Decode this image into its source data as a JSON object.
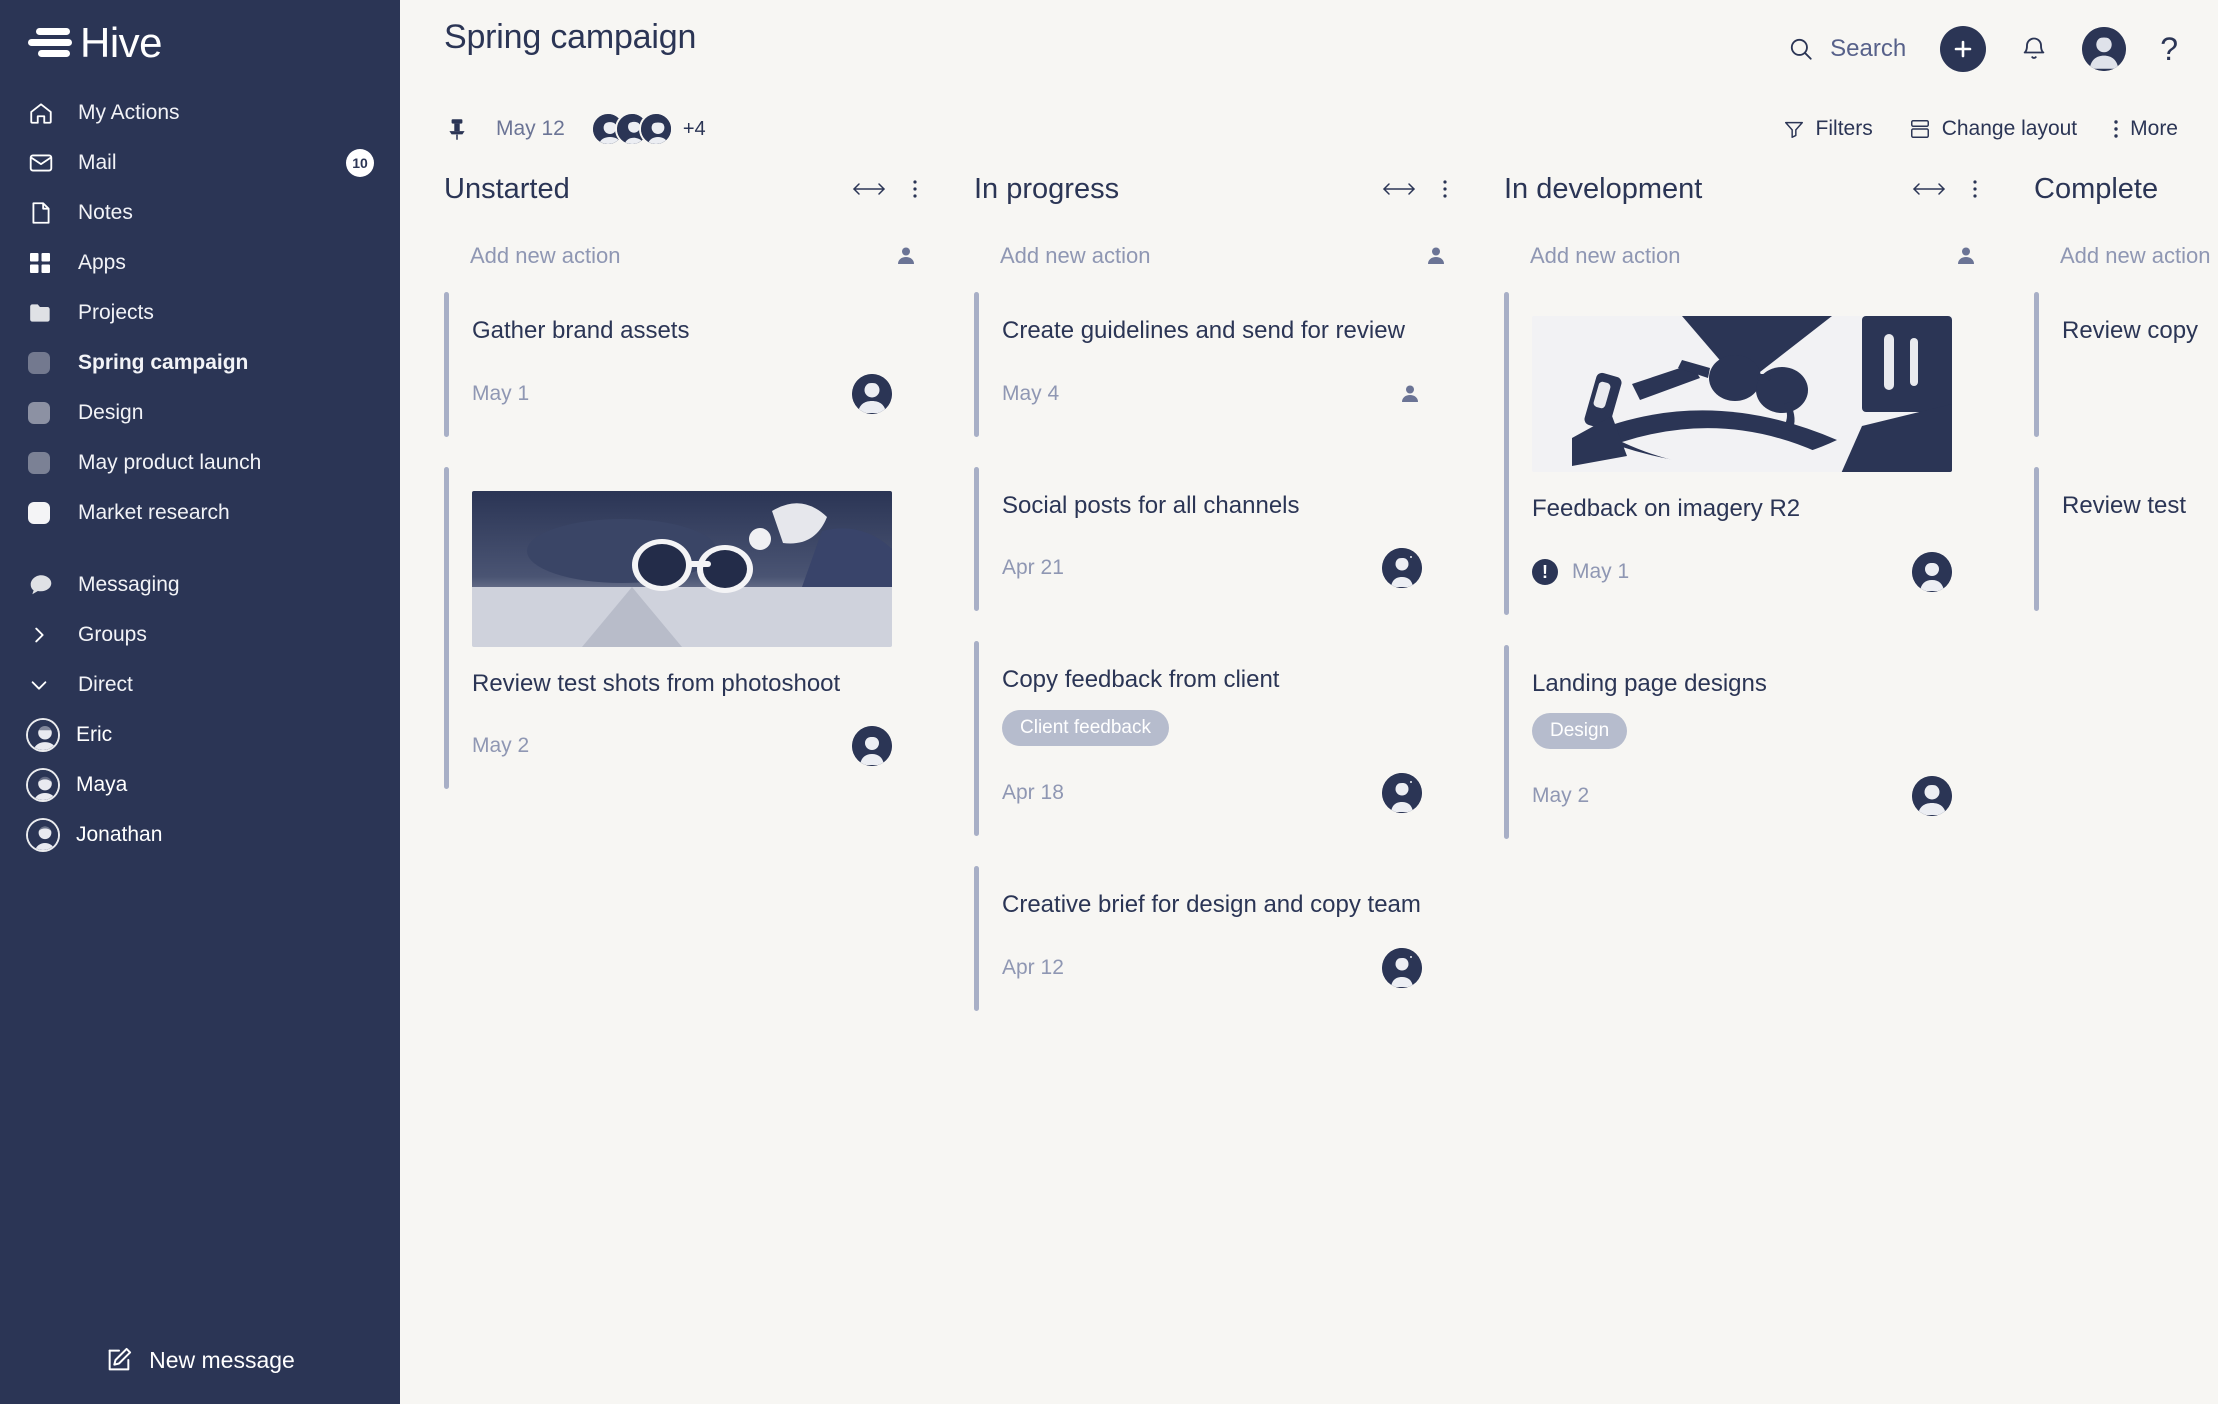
{
  "brand": {
    "name": "Hive"
  },
  "sidebar": {
    "nav": [
      {
        "label": "My Actions",
        "icon": "home-icon",
        "badge": null,
        "bold": false
      },
      {
        "label": "Mail",
        "icon": "mail-icon",
        "badge": "10",
        "bold": false
      },
      {
        "label": "Notes",
        "icon": "notes-icon",
        "badge": null,
        "bold": false
      },
      {
        "label": "Apps",
        "icon": "apps-icon",
        "badge": null,
        "bold": false
      },
      {
        "label": "Projects",
        "icon": "folder-icon",
        "badge": null,
        "bold": false
      }
    ],
    "projects": [
      {
        "label": "Spring campaign",
        "icon": "project-square-icon",
        "bold": true
      },
      {
        "label": "Design",
        "icon": "project-square-icon",
        "bold": false
      },
      {
        "label": "May product launch",
        "icon": "project-square-icon",
        "bold": false
      },
      {
        "label": "Market research",
        "icon": "project-square-icon",
        "bold": false
      }
    ],
    "messaging": {
      "label": "Messaging",
      "icon": "chat-bubble-icon"
    },
    "groups": {
      "label": "Groups",
      "icon": "chevron-right-icon"
    },
    "direct": {
      "label": "Direct",
      "icon": "chevron-down-icon"
    },
    "people": [
      {
        "name": "Eric"
      },
      {
        "name": "Maya"
      },
      {
        "name": "Jonathan"
      }
    ],
    "new_message": {
      "label": "New message",
      "icon": "compose-icon"
    }
  },
  "header": {
    "title": "Spring campaign",
    "search_placeholder": "Search",
    "add_button": "+",
    "help_button": "?",
    "meta": {
      "date": "May 12",
      "extra_members": "+4"
    },
    "tools": [
      {
        "label": "Filters",
        "icon": "filter-icon"
      },
      {
        "label": "Change layout",
        "icon": "layout-icon"
      },
      {
        "label": "More",
        "icon": "kebab-icon"
      }
    ]
  },
  "board": {
    "add_new_action_label": "Add new action",
    "columns": [
      {
        "title": "Unstarted",
        "cards": [
          {
            "title": "Gather brand assets",
            "date": "May 1",
            "tag": null,
            "image": null,
            "urgent": false,
            "assignee": "avatar-a"
          },
          {
            "title": "Review test shots from photoshoot",
            "date": "May 2",
            "tag": null,
            "image": "sunglasses-road-photo",
            "urgent": false,
            "assignee": "avatar-b"
          }
        ]
      },
      {
        "title": "In progress",
        "cards": [
          {
            "title": "Create guidelines and send for review",
            "date": "May 4",
            "tag": null,
            "image": null,
            "urgent": false,
            "assignee": null
          },
          {
            "title": "Social posts for all channels",
            "date": "Apr 21",
            "tag": null,
            "image": null,
            "urgent": false,
            "assignee": "avatar-c"
          },
          {
            "title": "Copy feedback from client",
            "date": "Apr 18",
            "tag": "Client feedback",
            "image": null,
            "urgent": false,
            "assignee": "avatar-c"
          },
          {
            "title": "Creative brief for design and copy team",
            "date": "Apr 12",
            "tag": null,
            "image": null,
            "urgent": false,
            "assignee": "avatar-c"
          }
        ]
      },
      {
        "title": "In development",
        "cards": [
          {
            "title": "Feedback on imagery R2",
            "date": "May 1",
            "tag": null,
            "image": "flatlay-accessories-photo",
            "urgent": true,
            "assignee": "avatar-b"
          },
          {
            "title": "Landing page designs",
            "date": "May 2",
            "tag": "Design",
            "image": null,
            "urgent": false,
            "assignee": "avatar-a"
          }
        ]
      },
      {
        "title": "Complete",
        "cards": [
          {
            "title": "Review copy",
            "date": "",
            "tag": null,
            "image": null,
            "urgent": false,
            "assignee": null
          },
          {
            "title": "Review test",
            "date": "",
            "tag": null,
            "image": null,
            "urgent": false,
            "assignee": null
          }
        ]
      }
    ]
  },
  "colors": {
    "sidebar_bg": "#2b3555",
    "canvas_bg": "#f7f6f3",
    "ink": "#2b3555",
    "muted": "#8f97b3",
    "tag_bg": "#b6bccd",
    "card_rail": "#a8afc6"
  }
}
